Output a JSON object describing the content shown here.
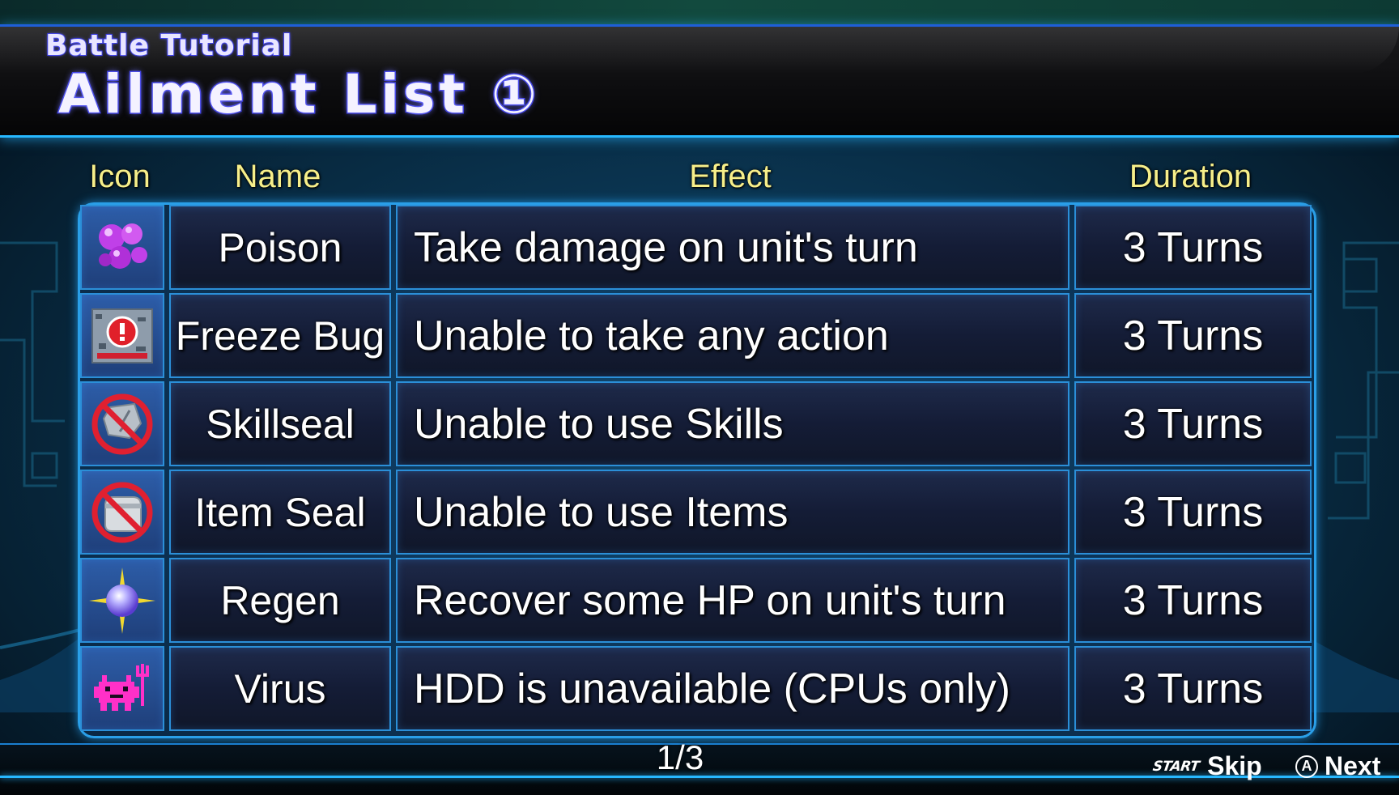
{
  "header": {
    "subtitle": "Battle Tutorial",
    "title": "Ailment List ①"
  },
  "table": {
    "columns": {
      "icon": "Icon",
      "name": "Name",
      "effect": "Effect",
      "duration": "Duration"
    },
    "rows": [
      {
        "icon": "poison-bubbles-icon",
        "name": "Poison",
        "effect": "Take damage on unit's turn",
        "duration": "3 Turns"
      },
      {
        "icon": "freeze-bug-error-icon",
        "name": "Freeze Bug",
        "effect": "Unable to take any action",
        "duration": "3 Turns"
      },
      {
        "icon": "skillseal-prohibited-icon",
        "name": "Skillseal",
        "effect": "Unable to use Skills",
        "duration": "3 Turns"
      },
      {
        "icon": "item-seal-prohibited-icon",
        "name": "Item Seal",
        "effect": "Unable to use Items",
        "duration": "3 Turns"
      },
      {
        "icon": "regen-orb-icon",
        "name": "Regen",
        "effect": "Recover some HP on unit's turn",
        "duration": "3 Turns"
      },
      {
        "icon": "virus-devil-icon",
        "name": "Virus",
        "effect": "HDD is unavailable (CPUs only)",
        "duration": "3 Turns"
      }
    ]
  },
  "footer": {
    "page": "1/3",
    "skip_badge": "START",
    "skip_label": "Skip",
    "next_badge": "A",
    "next_label": "Next"
  },
  "colors": {
    "header_text": "#f7ef8a",
    "cell_border": "#2b8fd8",
    "title_stroke": "#3a3ce0"
  }
}
